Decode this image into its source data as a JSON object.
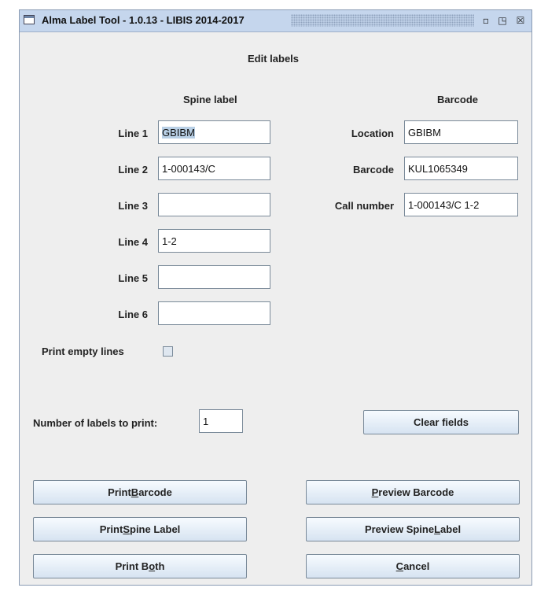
{
  "window": {
    "title": "Alma Label Tool - 1.0.13 - LIBIS 2014-2017",
    "controls": {
      "minimize": "▫",
      "maximize": "◳",
      "close": "☒"
    }
  },
  "heading": "Edit labels",
  "spine": {
    "header": "Spine label",
    "lines": [
      {
        "label": "Line 1",
        "value": "GBIBM",
        "selected": true
      },
      {
        "label": "Line 2",
        "value": "1-000143/C"
      },
      {
        "label": "Line 3",
        "value": ""
      },
      {
        "label": "Line 4",
        "value": "1-2"
      },
      {
        "label": "Line 5",
        "value": ""
      },
      {
        "label": "Line 6",
        "value": ""
      }
    ],
    "print_empty_lines": {
      "label": "Print empty lines",
      "checked": false
    }
  },
  "barcode": {
    "header": "Barcode",
    "fields": [
      {
        "label": "Location",
        "value": "GBIBM"
      },
      {
        "label": "Barcode",
        "value": "KUL1065349"
      },
      {
        "label": "Call number",
        "value": "1-000143/C 1-2"
      }
    ]
  },
  "labels_to_print": {
    "label": "Number of labels to print:",
    "value": "1"
  },
  "buttons": {
    "clear": "Clear fields",
    "print_barcode": {
      "pre": "Print ",
      "mn": "B",
      "post": "arcode"
    },
    "preview_barcode": {
      "pre": "",
      "mn": "P",
      "post": "review Barcode"
    },
    "print_spine": {
      "pre": "Print ",
      "mn": "S",
      "post": "pine Label"
    },
    "preview_spine": {
      "pre": "Preview Spine ",
      "mn": "L",
      "post": "abel"
    },
    "print_both": {
      "pre": "Print B",
      "mn": "o",
      "post": "th"
    },
    "cancel": {
      "pre": "",
      "mn": "C",
      "post": "ancel"
    }
  },
  "colors": {
    "titlebar": "#c5d6ed",
    "background": "#eeeeee",
    "selection": "#b8cfe5"
  }
}
